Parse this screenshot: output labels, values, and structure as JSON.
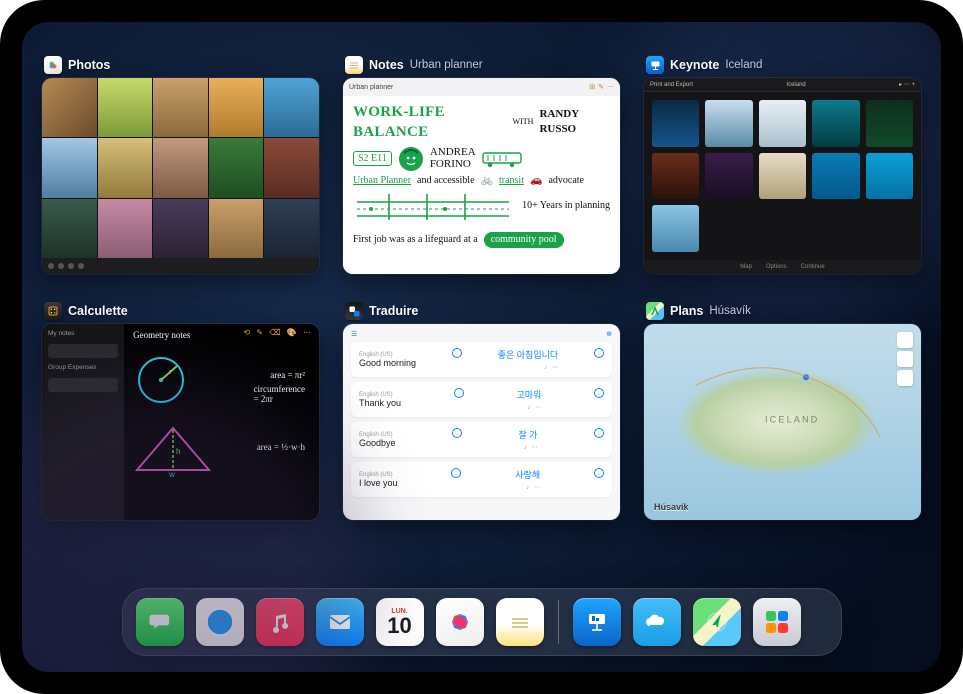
{
  "apps": {
    "photos": {
      "name": "Photos",
      "subtitle": ""
    },
    "notes": {
      "name": "Notes",
      "subtitle": "Urban planner"
    },
    "keynote": {
      "name": "Keynote",
      "subtitle": "Iceland"
    },
    "calculette": {
      "name": "Calculette",
      "subtitle": ""
    },
    "traduire": {
      "name": "Traduire",
      "subtitle": ""
    },
    "plans": {
      "name": "Plans",
      "subtitle": "Húsavík"
    }
  },
  "notes_preview": {
    "doc_title": "Urban planner",
    "line1": "WORK-LIFE BALANCE",
    "line1_with": "WITH",
    "line1_name": "RANDY RUSSO",
    "badge": "S2 E11",
    "guest_first": "ANDREA",
    "guest_last": "FORINO",
    "line3a": "Urban Planner",
    "line3b": "and accessible",
    "line3c": "transit",
    "line3d": "advocate",
    "line4": "10+ Years in planning",
    "line5a": "First job was as a lifeguard at a",
    "line5b": "community pool"
  },
  "keynote_preview": {
    "doc_title": "Iceland",
    "top_left": "Print and Export",
    "bottom_items": [
      "Map",
      "Options",
      "Continue"
    ]
  },
  "calculette_preview": {
    "right_title": "Geometry notes",
    "sidebar_items": [
      "My notes",
      "Group Expenses"
    ],
    "formula_area": "area = πr²",
    "formula_circ": "circumference",
    "formula_circ2": "= 2πr",
    "formula_tri": "area = ½·w·h"
  },
  "traduire_preview": {
    "src_lang": "English (US)",
    "rows": [
      {
        "src": "Good morning",
        "tgt": "좋은 아침입니다"
      },
      {
        "src": "Thank you",
        "tgt": "고마워"
      },
      {
        "src": "Goodbye",
        "tgt": "잘 가"
      },
      {
        "src": "I love you",
        "tgt": "사랑해"
      }
    ]
  },
  "plans_preview": {
    "label": "Húsavík",
    "region": "ICELAND"
  },
  "dock": {
    "calendar_day_label": "LUN.",
    "calendar_day_num": "10"
  }
}
